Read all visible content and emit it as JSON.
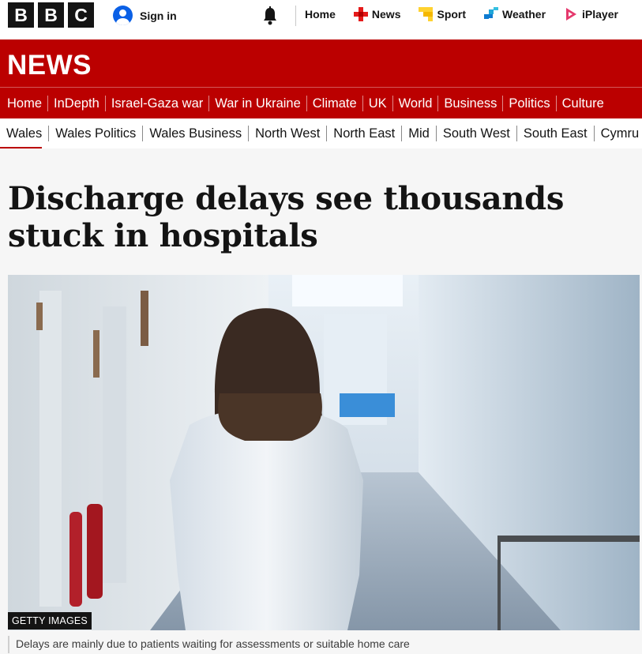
{
  "masthead": {
    "logo_letters": [
      "B",
      "B",
      "C"
    ],
    "sign_in_label": "Sign in",
    "nav": [
      {
        "label": "Home",
        "icon": "none"
      },
      {
        "label": "News",
        "icon": "news-icon"
      },
      {
        "label": "Sport",
        "icon": "sport-icon"
      },
      {
        "label": "Weather",
        "icon": "weather-icon"
      },
      {
        "label": "iPlayer",
        "icon": "iplayer-icon"
      }
    ]
  },
  "news_banner": {
    "logo_text": "NEWS",
    "background": "#bb0000",
    "nav": [
      "Home",
      "InDepth",
      "Israel-Gaza war",
      "War in Ukraine",
      "Climate",
      "UK",
      "World",
      "Business",
      "Politics",
      "Culture"
    ],
    "active": "UK"
  },
  "sub_nav": {
    "items": [
      "Wales",
      "Wales Politics",
      "Wales Business",
      "North West",
      "North East",
      "Mid",
      "South West",
      "South East",
      "Cymru"
    ],
    "active": "Wales"
  },
  "article": {
    "headline": "Discharge delays see thousands stuck in hospitals",
    "image_credit": "GETTY IMAGES",
    "image_caption": "Delays are mainly due to patients waiting for assessments or suitable home care"
  }
}
